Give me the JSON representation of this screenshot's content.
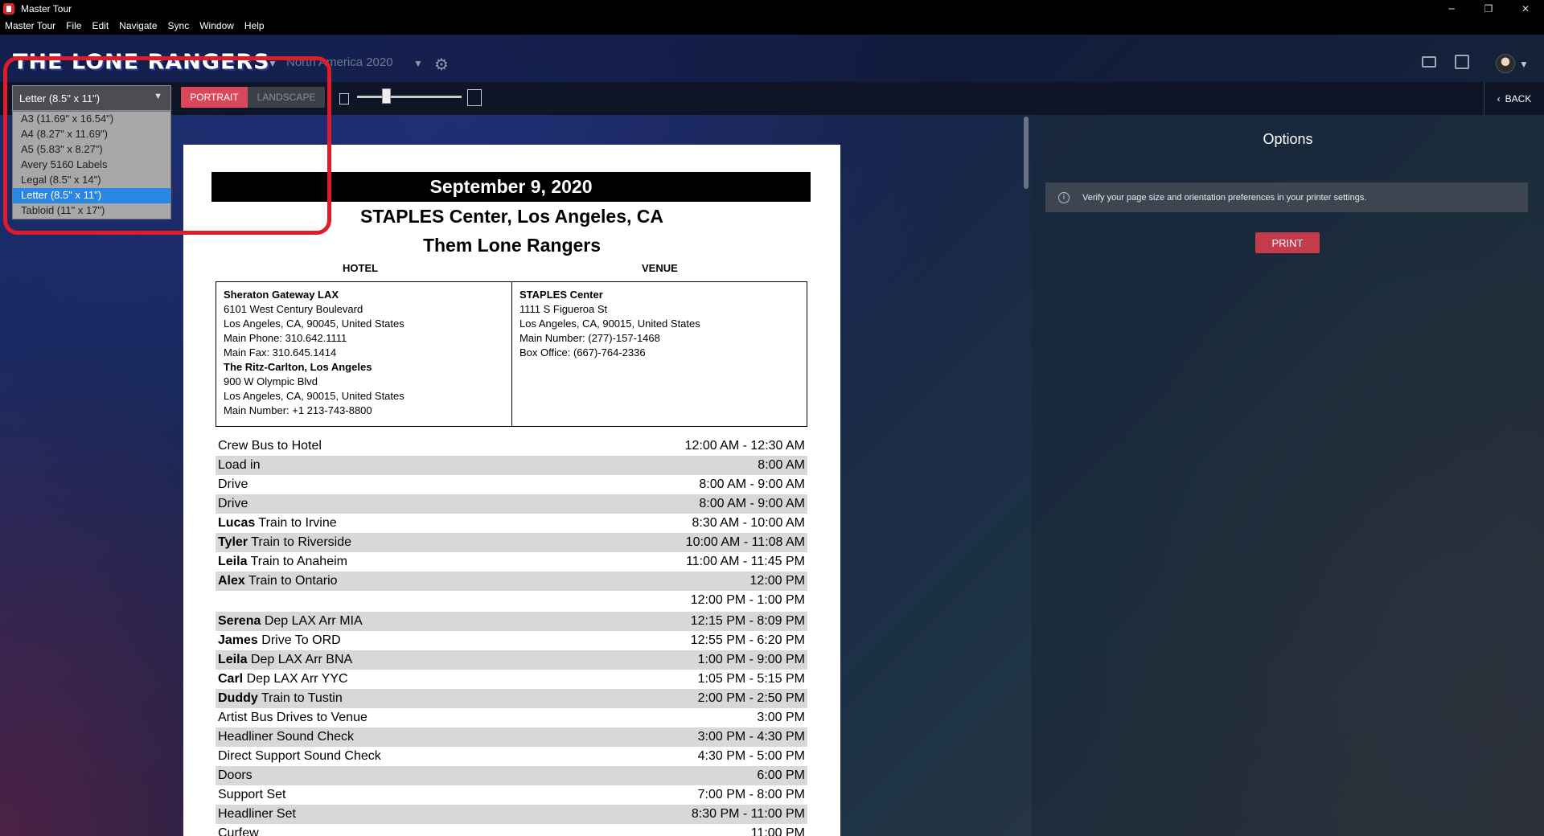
{
  "window": {
    "title": "Master Tour",
    "controls": [
      "─",
      "❐",
      "✕"
    ]
  },
  "menu": [
    "Master Tour",
    "File",
    "Edit",
    "Navigate",
    "Sync",
    "Window",
    "Help"
  ],
  "header": {
    "logo_text": "THE LONE RANGERS",
    "tour_name": "North America 2020"
  },
  "toolbar": {
    "page_size_selected": "Letter (8.5\" x 11\")",
    "portrait": "PORTRAIT",
    "landscape": "LANDSCAPE",
    "zoom_level": 0.28,
    "back": "BACK"
  },
  "page_sizes": [
    "A3 (11.69\" x 16.54\")",
    "A4 (8.27\" x 11.69\")",
    "A5 (5.83\" x 8.27\")",
    "Avery 5160 Labels",
    "Legal (8.5\" x 14\")",
    "Letter (8.5\" x 11\")",
    "Tabloid (11\" x 17\")"
  ],
  "selected_index": 5,
  "options": {
    "title": "Options",
    "info": "Verify your page size and orientation preferences in your printer settings.",
    "print": "PRINT"
  },
  "sheet": {
    "date": "September 9, 2020",
    "venue_line": "STAPLES Center, Los Angeles, CA",
    "band": "Them Lone Rangers",
    "hotel_heading": "HOTEL",
    "venue_heading": "VENUE",
    "hotel_lines": [
      {
        "text": "Sheraton Gateway LAX",
        "bold": true
      },
      {
        "text": "6101 West Century Boulevard",
        "bold": false
      },
      {
        "text": "Los Angeles, CA, 90045, United States",
        "bold": false
      },
      {
        "text": "Main Phone: 310.642.1111",
        "bold": false
      },
      {
        "text": "Main Fax: 310.645.1414",
        "bold": false
      },
      {
        "text": "The Ritz-Carlton, Los Angeles",
        "bold": true
      },
      {
        "text": "900 W Olympic Blvd",
        "bold": false
      },
      {
        "text": "Los Angeles, CA, 90015, United States",
        "bold": false
      },
      {
        "text": "Main Number: +1 213-743-8800",
        "bold": false
      }
    ],
    "venue_lines": [
      {
        "text": "STAPLES Center",
        "bold": true
      },
      {
        "text": "1111 S Figueroa St",
        "bold": false
      },
      {
        "text": "Los Angeles, CA, 90015, United States",
        "bold": false
      },
      {
        "text": "Main Number: (277)-157-1468",
        "bold": false
      },
      {
        "text": "Box Office: (667)-764-2336",
        "bold": false
      }
    ],
    "schedule": [
      {
        "who": "",
        "what": "Crew Bus to Hotel",
        "time": "12:00 AM - 12:30 AM"
      },
      {
        "who": "",
        "what": "Load in",
        "time": "8:00 AM"
      },
      {
        "who": "",
        "what": "Drive",
        "time": "8:00 AM - 9:00 AM"
      },
      {
        "who": "",
        "what": "Drive",
        "time": "8:00 AM - 9:00 AM"
      },
      {
        "who": "Lucas",
        "what": "Train to Irvine",
        "time": "8:30 AM - 10:00 AM"
      },
      {
        "who": "Tyler",
        "what": "Train to Riverside",
        "time": "10:00 AM - 11:08 AM"
      },
      {
        "who": "Leila",
        "what": "Train to Anaheim",
        "time": "11:00 AM - 11:45 PM"
      },
      {
        "who": "Alex",
        "what": "Train to Ontario",
        "time": "12:00 PM"
      },
      {
        "who": "",
        "what": "",
        "time": "12:00 PM - 1:00 PM"
      },
      {
        "who": "Serena",
        "what": "Dep LAX Arr MIA",
        "time": "12:15 PM - 8:09 PM"
      },
      {
        "who": "James",
        "what": "Drive To ORD",
        "time": "12:55 PM - 6:20 PM"
      },
      {
        "who": "Leila",
        "what": "Dep LAX Arr BNA",
        "time": "1:00 PM - 9:00 PM"
      },
      {
        "who": "Carl",
        "what": "Dep LAX Arr YYC",
        "time": "1:05 PM - 5:15 PM"
      },
      {
        "who": "Duddy",
        "what": "Train to Tustin",
        "time": "2:00 PM - 2:50 PM"
      },
      {
        "who": "",
        "what": "Artist Bus Drives to Venue",
        "time": "3:00 PM"
      },
      {
        "who": "",
        "what": "Headliner Sound Check",
        "time": "3:00 PM - 4:30 PM"
      },
      {
        "who": "",
        "what": "Direct Support Sound Check",
        "time": "4:30 PM - 5:00 PM"
      },
      {
        "who": "",
        "what": "Doors",
        "time": "6:00 PM"
      },
      {
        "who": "",
        "what": "Support Set",
        "time": "7:00 PM - 8:00 PM"
      },
      {
        "who": "",
        "what": "Headliner Set",
        "time": "8:30 PM - 11:00 PM"
      },
      {
        "who": "",
        "what": "Curfew",
        "time": "11:00 PM"
      }
    ]
  }
}
